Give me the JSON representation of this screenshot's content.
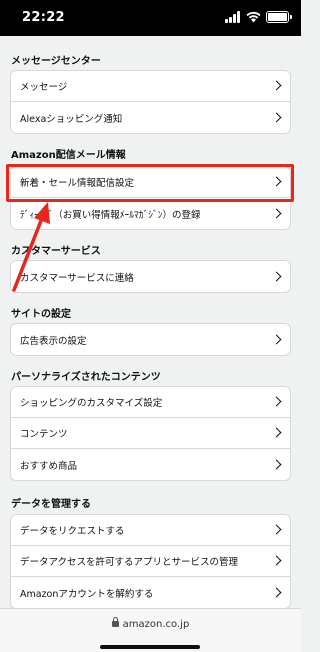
{
  "status_bar": {
    "time": "22:22"
  },
  "colors": {
    "highlight": "#e8261b",
    "background": "#f0f2f2",
    "card": "#ffffff"
  },
  "sections": [
    {
      "title": "メッセージセンター",
      "items": [
        "メッセージ",
        "Alexaショッピング通知"
      ]
    },
    {
      "title": "Amazon配信メール情報",
      "items": [
        "新着・セール情報配信設定",
        "ﾃﾞｨｰﾙｽﾞ（お買い得情報ﾒｰﾙﾏｶﾞｼﾞﾝ）の登録"
      ]
    },
    {
      "title": "カスタマーサービス",
      "items": [
        "カスタマーサービスに連絡"
      ]
    },
    {
      "title": "サイトの設定",
      "items": [
        "広告表示の設定"
      ]
    },
    {
      "title": "パーソナライズされたコンテンツ",
      "items": [
        "ショッピングのカスタマイズ設定",
        "コンテンツ",
        "おすすめ商品"
      ]
    },
    {
      "title": "データを管理する",
      "items": [
        "データをリクエストする",
        "データアクセスを許可するアプリとサービスの管理",
        "Amazonアカウントを解約する"
      ]
    }
  ],
  "browser": {
    "url": "amazon.co.jp"
  }
}
